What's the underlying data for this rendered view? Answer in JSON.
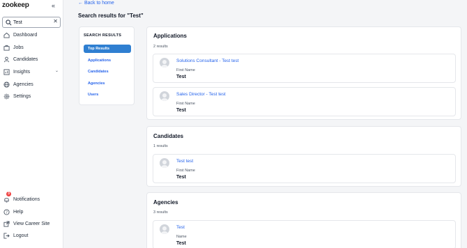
{
  "brand": {
    "logo": "zookeep"
  },
  "search": {
    "value": "Test",
    "placeholder": "Search"
  },
  "nav": {
    "items": [
      {
        "label": "Dashboard"
      },
      {
        "label": "Jobs"
      },
      {
        "label": "Candidates"
      },
      {
        "label": "Insights"
      },
      {
        "label": "Agencies"
      },
      {
        "label": "Settings"
      }
    ],
    "bottom": [
      {
        "label": "Notifications",
        "badge": "3"
      },
      {
        "label": "Help"
      },
      {
        "label": "View Career Site"
      },
      {
        "label": "Logout"
      }
    ]
  },
  "back_link": "← Back to home",
  "heading": "Search results for \"Test\"",
  "filters": {
    "title": "SEARCH RESULTS",
    "items": [
      "Top Results",
      "Applications",
      "Candidates",
      "Agencies",
      "Users"
    ]
  },
  "sections": {
    "applications": {
      "title": "Applications",
      "count": "2 results",
      "results": [
        {
          "title": "Solutions Consultant - Test test",
          "label": "First Name",
          "value": "Test"
        },
        {
          "title": "Sales Director - Test test",
          "label": "First Name",
          "value": "Test"
        }
      ]
    },
    "candidates": {
      "title": "Candidates",
      "count": "1 results",
      "results": [
        {
          "title": "Test test",
          "label": "First Name",
          "value": "Test"
        }
      ]
    },
    "agencies": {
      "title": "Agencies",
      "count": "3 results",
      "results": [
        {
          "title": "Test",
          "label": "Name",
          "value": "Test"
        }
      ]
    }
  },
  "colors": {
    "accent": "#2f7fd1",
    "link": "#2563eb",
    "badge": "#ef4444"
  }
}
